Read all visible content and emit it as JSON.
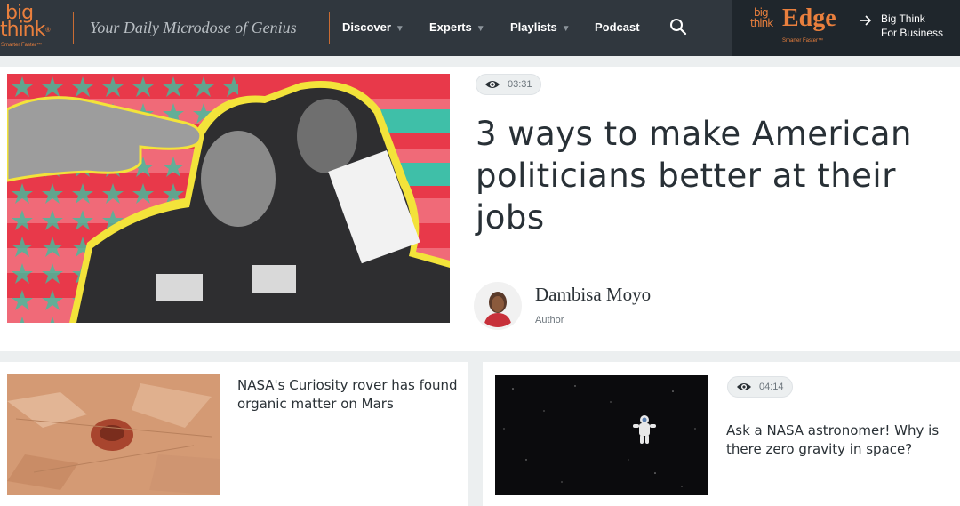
{
  "header": {
    "logo": {
      "word1": "big",
      "word2": "think",
      "registered": "®",
      "slogan": "Smarter Faster™"
    },
    "tagline": "Your Daily Microdose of Genius",
    "nav": [
      {
        "label": "Discover",
        "has_dropdown": true
      },
      {
        "label": "Experts",
        "has_dropdown": true
      },
      {
        "label": "Playlists",
        "has_dropdown": true
      },
      {
        "label": "Podcast",
        "has_dropdown": false
      }
    ],
    "caret": "▼",
    "search_icon": "search-icon",
    "edge": {
      "word1": "big",
      "word2": "think",
      "name": "Edge",
      "slogan": "Smarter Faster™",
      "cta_line1": "Big Think",
      "cta_line2": "For Business",
      "arrow_icon": "arrow-right-icon"
    }
  },
  "hero": {
    "image_icon": "hero-collage-image",
    "duration": "03:31",
    "views_icon": "eye-icon",
    "title": "3 ways to make American politicians better at their jobs",
    "author": "Dambisa Moyo",
    "role": "Author"
  },
  "cards": [
    {
      "title": "NASA's Curiosity rover has found organic matter on Mars",
      "image_icon": "mars-surface-image"
    },
    {
      "title": "Ask a NASA astronomer! Why is there zero gravity in space?",
      "duration": "04:14",
      "image_icon": "astronaut-space-image"
    }
  ],
  "colors": {
    "brand_orange": "#e97f3d",
    "header_bg": "#30373e",
    "edge_bg": "#1f262c",
    "page_bg": "#eceff0",
    "text_dark": "#283036"
  }
}
